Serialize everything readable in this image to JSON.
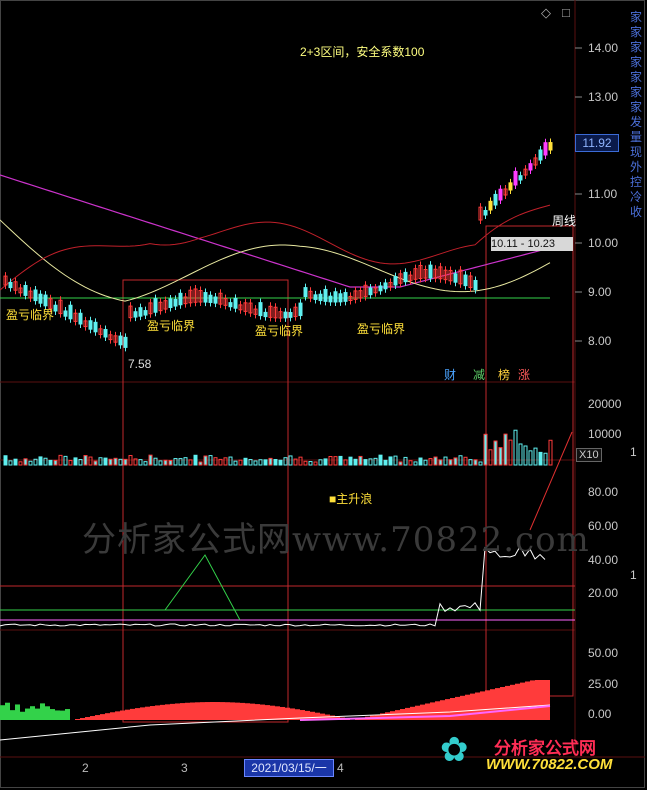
{
  "header": {
    "zone_label": "2+3区间，安全系数100",
    "top_icons": [
      "diamond-icon",
      "square-icon"
    ]
  },
  "price_axis": {
    "ticks": [
      "14.00",
      "13.00",
      "12.00",
      "11.00",
      "10.00",
      "9.00",
      "8.00"
    ],
    "current_price": "11.92",
    "range_label": "10.11 - 10.23",
    "weekly_label": "周线",
    "low_marker": "7.58",
    "profit_loss_labels": [
      "盈亏临界",
      "盈亏临界",
      "盈亏临界",
      "盈亏临界"
    ]
  },
  "badges": [
    {
      "label": "财",
      "color": "#4aa3ff"
    },
    {
      "label": "减",
      "color": "#5fd06a"
    },
    {
      "label": "榜",
      "color": "#ffd23c"
    },
    {
      "label": "涨",
      "color": "#ff5a5a"
    }
  ],
  "volume_axis": {
    "ticks": [
      "20000",
      "10000"
    ],
    "multiplier": "X10"
  },
  "indicator1": {
    "label": "主升浪",
    "ticks": [
      "80.00",
      "60.00",
      "40.00",
      "20.00"
    ]
  },
  "indicator2": {
    "ticks": [
      "50.00",
      "25.00",
      "0.00"
    ]
  },
  "time_axis": {
    "labels": [
      "2",
      "3",
      "4"
    ],
    "cursor_date": "2021/03/15/一"
  },
  "side_strip_text": "家家家家家家家发量现外控冷收",
  "side_numbers": [
    "1",
    "1"
  ],
  "watermark": {
    "text": "分析家公式网www.70822.com",
    "logo_name": "分析家公式网",
    "logo_url": "WWW.70822.COM"
  },
  "colors": {
    "up": "#ff3b3b",
    "down": "#5ff0f0",
    "yellow": "#ffe03a",
    "magenta": "#ff3cff",
    "green": "#33d24a"
  }
}
